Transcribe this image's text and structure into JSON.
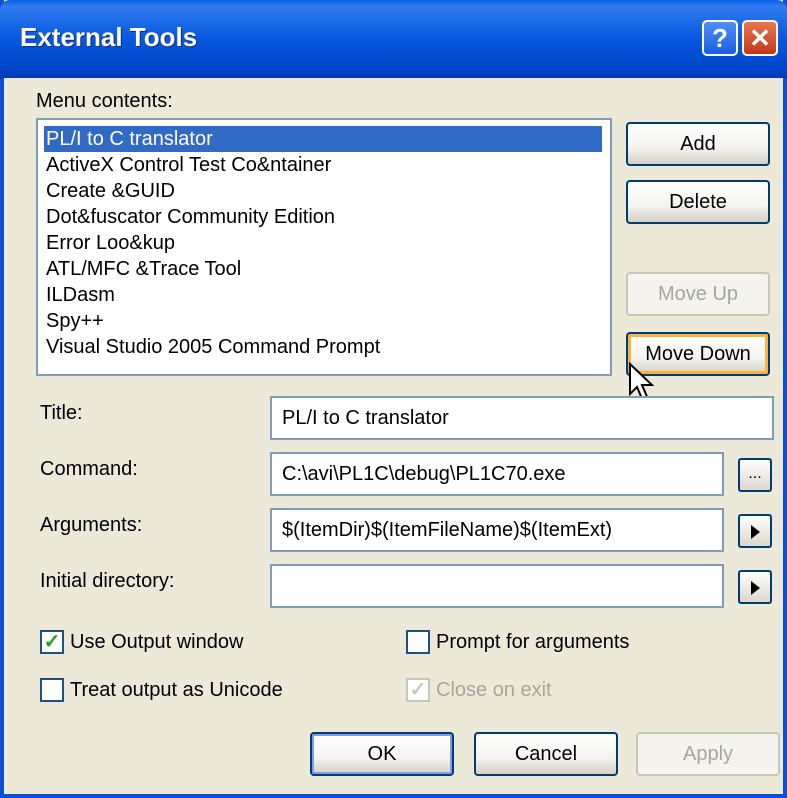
{
  "window": {
    "title": "External Tools",
    "help_glyph": "?",
    "close_glyph": "✕"
  },
  "menu_contents_label": "Menu contents:",
  "menu_items": [
    "PL/I to C translator",
    "ActiveX Control Test Co&ntainer",
    "Create &GUID",
    "Dot&fuscator Community Edition",
    "Error Loo&kup",
    "ATL/MFC &Trace Tool",
    "ILDasm",
    "Spy++",
    "Visual Studio 2005 Command Prompt"
  ],
  "selected_index": 0,
  "buttons": {
    "add": "Add",
    "delete": "Delete",
    "move_up": "Move Up",
    "move_down": "Move Down",
    "ok": "OK",
    "cancel": "Cancel",
    "apply": "Apply"
  },
  "fields": {
    "title_label": "Title:",
    "title_value": "PL/I to C translator",
    "command_label": "Command:",
    "command_value": "C:\\avi\\PL1C\\debug\\PL1C70.exe",
    "browse_glyph": "...",
    "arguments_label": "Arguments:",
    "arguments_value": "$(ItemDir)$(ItemFileName)$(ItemExt)",
    "initial_dir_label": "Initial directory:",
    "initial_dir_value": ""
  },
  "checkboxes": {
    "use_output_window": {
      "label": "Use Output window",
      "checked": true
    },
    "prompt_for_arguments": {
      "label": "Prompt for arguments",
      "checked": false
    },
    "treat_output_unicode": {
      "label": "Treat output as Unicode",
      "checked": false
    },
    "close_on_exit": {
      "label": "Close on exit",
      "checked": true,
      "disabled": true
    }
  },
  "check_glyph": "✓"
}
